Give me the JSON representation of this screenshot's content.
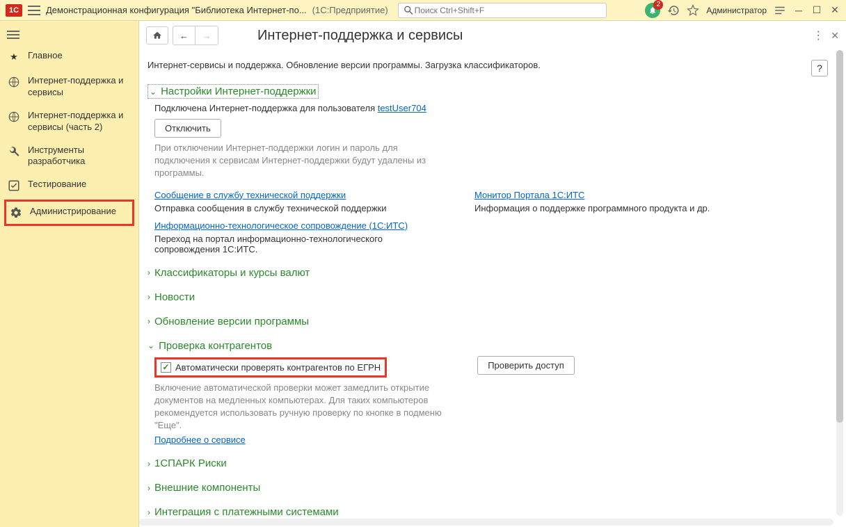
{
  "titlebar": {
    "logo": "1C",
    "title": "Демонстрационная конфигурация \"Библиотека Интернет-по...",
    "subtitle": "(1С:Предприятие)",
    "search_placeholder": "Поиск Ctrl+Shift+F",
    "badge_count": "2",
    "user_label": "Администратор"
  },
  "sidebar": {
    "items": [
      {
        "label": "Главное"
      },
      {
        "label": "Интернет-поддержка и сервисы"
      },
      {
        "label": "Интернет-поддержка и сервисы (часть 2)"
      },
      {
        "label": "Инструменты разработчика"
      },
      {
        "label": "Тестирование"
      },
      {
        "label": "Администрирование"
      }
    ]
  },
  "page": {
    "title": "Интернет-поддержка и сервисы",
    "description": "Интернет-сервисы и поддержка. Обновление версии программы. Загрузка классификаторов.",
    "help": "?"
  },
  "support": {
    "header": "Настройки Интернет-поддержки",
    "connected_text": "Подключена Интернет-поддержка для пользователя ",
    "user_link": "testUser704",
    "disable_btn": "Отключить",
    "disable_hint": "При отключении Интернет-поддержки логин и пароль для подключения к сервисам Интернет-поддержки будут удалены из программы."
  },
  "links": {
    "left1": "Сообщение в службу технической поддержки",
    "left1_desc": "Отправка сообщения в службу технической поддержки",
    "left2": "Информационно-технологическое сопровождение (1С:ИТС)",
    "left2_desc": "Переход на портал информационно-технологического сопровождения 1С:ИТС.",
    "right1": "Монитор Портала 1С:ИТС",
    "right1_desc": "Информация о поддержке программного продукта и др."
  },
  "sections": {
    "s1": "Классификаторы и курсы валют",
    "s2": "Новости",
    "s3": "Обновление версии программы",
    "s4": "Проверка контрагентов",
    "s5": "1СПАРК Риски",
    "s6": "Внешние компоненты",
    "s7": "Интеграция с платежными системами"
  },
  "counterparty": {
    "checkbox_label": "Автоматически проверять контрагентов по ЕГРН",
    "button": "Проверить доступ",
    "hint": "Включение автоматической проверки может замедлить открытие документов на медленных компьютерах. Для таких компьютеров рекомендуется использовать ручную проверку по кнопке в подменю \"Еще\".",
    "more_link": "Подробнее о сервисе"
  }
}
